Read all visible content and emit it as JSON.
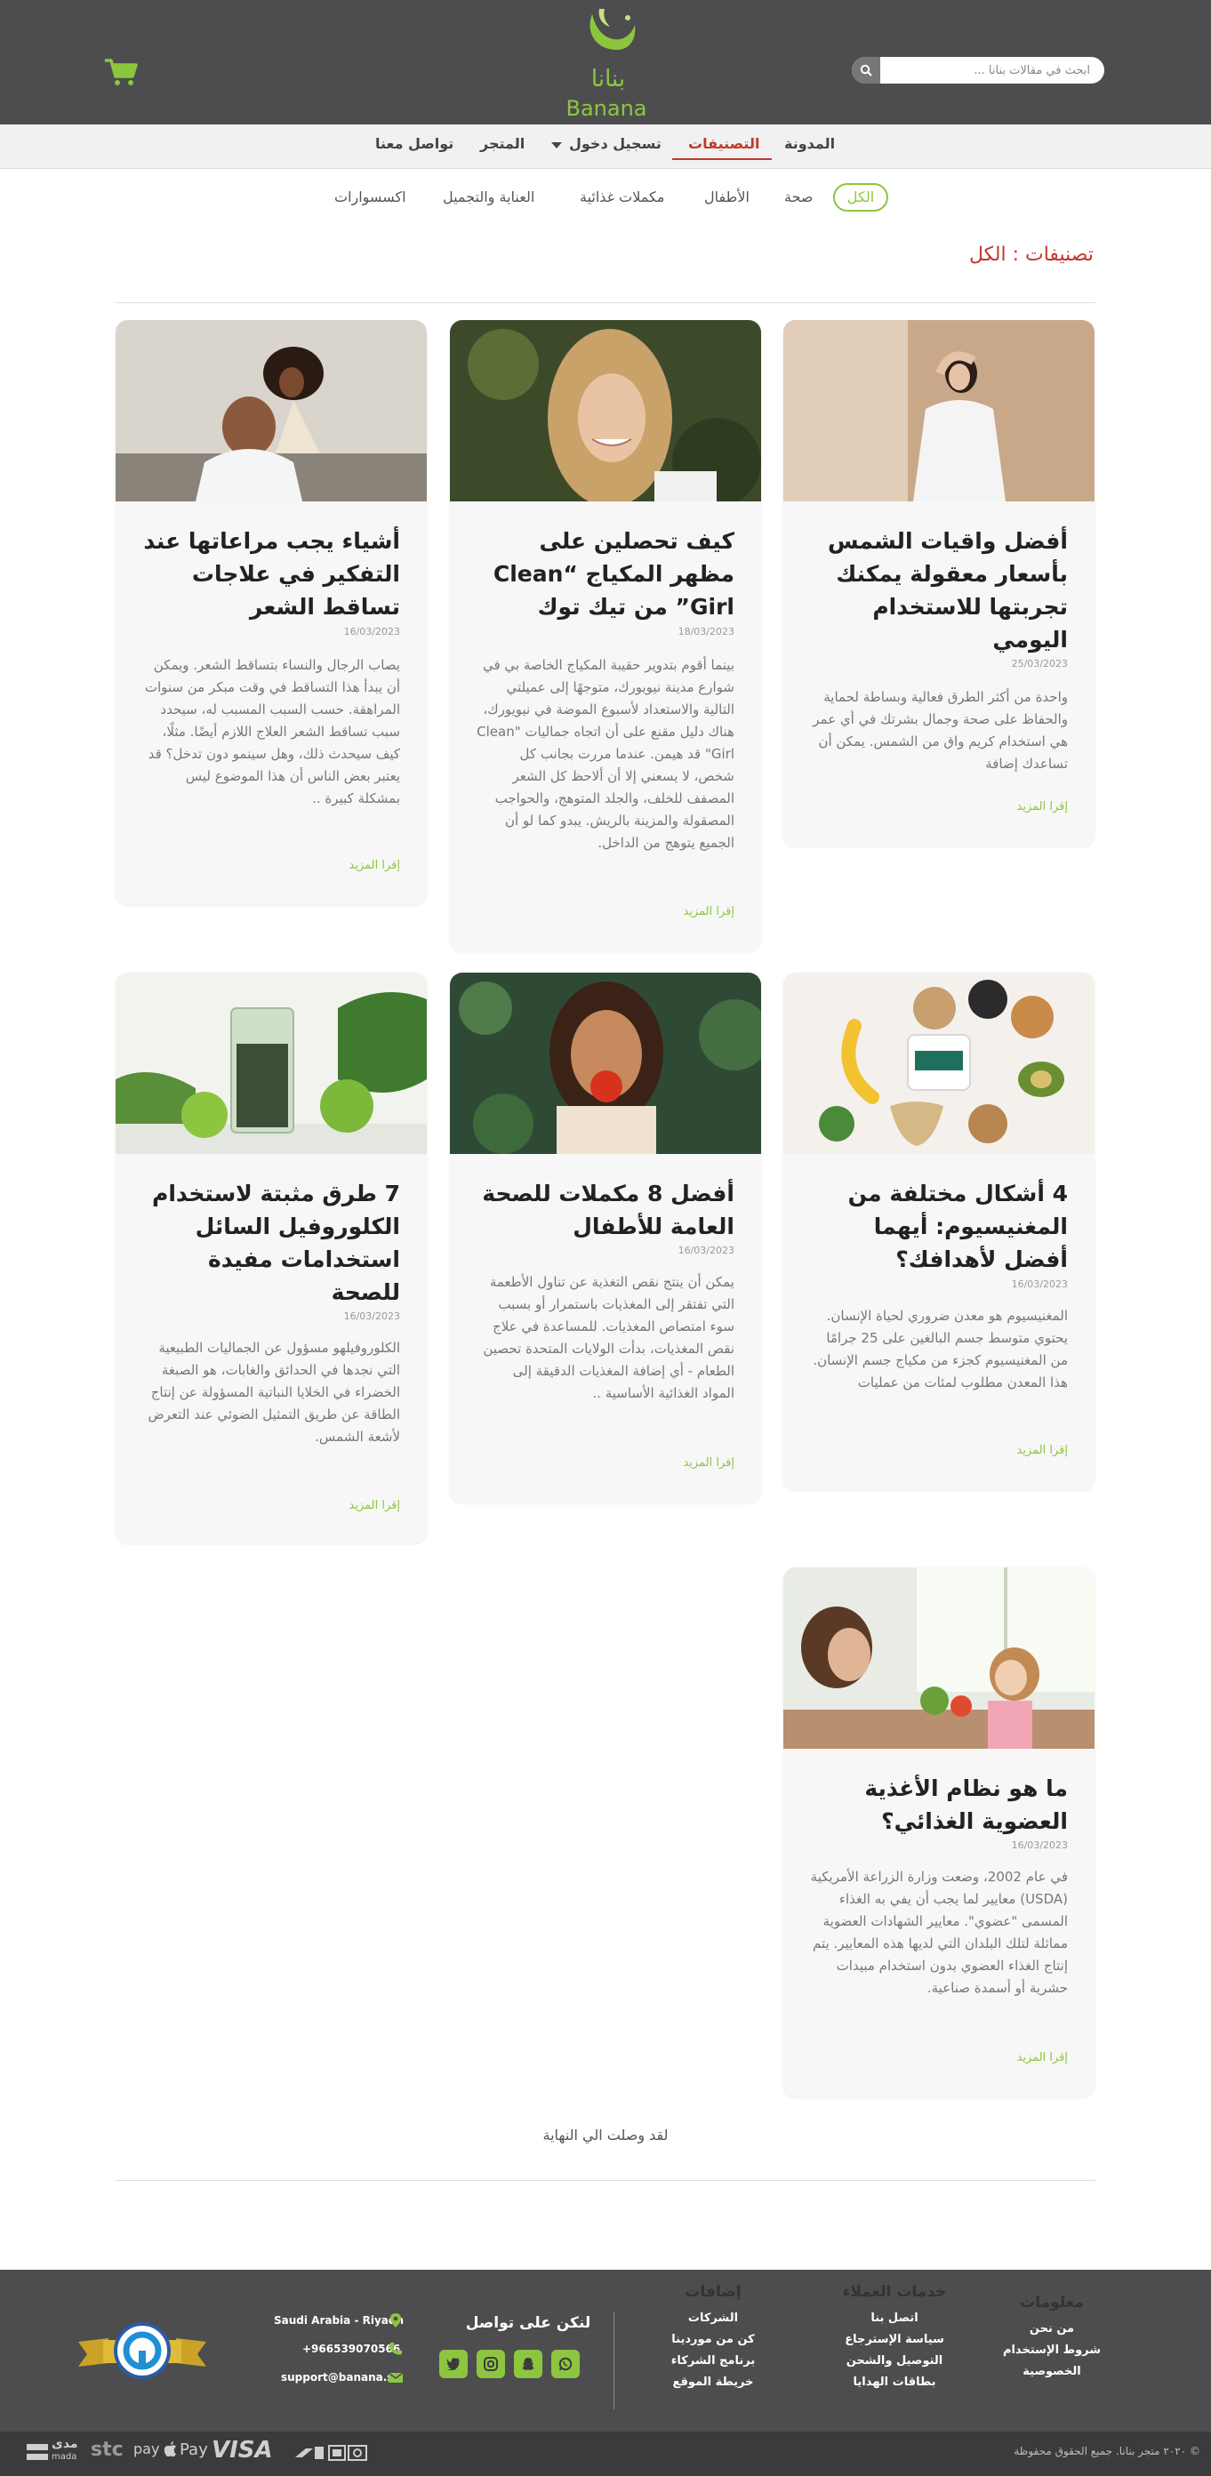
{
  "header": {
    "search_placeholder": "ابحث في مقالات بنانا ...",
    "logo_ar": "بنانا",
    "logo_en": "Banana"
  },
  "nav": {
    "items": [
      "المدونة",
      "التصنيفات",
      "تسجيل دخول",
      "المتجر",
      "تواصل معنا"
    ]
  },
  "categories": [
    "الكل",
    "صحة",
    "الأطفال",
    "مكملات غذائية",
    "العناية والتجميل",
    "اكسسوارات"
  ],
  "page_title": "تصنيفات : الكل",
  "posts": [
    {
      "title": "أفضل واقيات الشمس بأسعار معقولة يمكنك تجربتها للاستخدام اليومي",
      "date": "25/03/2023",
      "excerpt": "واحدة من أكثر الطرق فعالية وبساطة لحماية والحفاظ على صحة وجمال بشرتك في أي عمر هي استخدام كريم واق من الشمس. يمكن أن تساعدك إضافة",
      "more": "إقرا المزيد"
    },
    {
      "title": "كيف تحصلين على مظهر المكياج “Clean Girl” من تيك توك",
      "date": "18/03/2023",
      "excerpt": "بينما أقوم بتدوير حقيبة المكياج الخاصة بي في شوارع مدينة نيويورك، متوجهًا إلى عميلتي التالية والاستعداد لأسبوع الموضة في نيويورك، هناك دليل مقنع على أن اتجاه جماليات \"Clean Girl\" قد هيمن. عندما مررت بجانب كل شخص، لا يسعني إلا أن ألاحظ كل الشعر المصفف للخلف، والجلد المتوهج، والحواجب المصقولة والمزينة بالريش. يبدو كما لو أن الجميع يتوهج من الداخل.",
      "more": "إقرا المزيد"
    },
    {
      "title": "أشياء يجب مراعاتها عند التفكير في علاجات تساقط الشعر",
      "date": "16/03/2023",
      "excerpt": "يصاب الرجال والنساء بتساقط الشعر. ويمكن أن يبدأ هذا التساقط في وقت مبكر من سنوات المراهقة. حسب السبب المسبب له، سيحدد سبب تساقط الشعر العلاج اللازم أيضًا. مثلًا، كيف سيحدث ذلك، وهل سينمو دون تدخل؟ قد يعتبر بعض الناس أن هذا الموضوع ليس بمشكلة كبيرة ..",
      "more": "إقرا المزيد"
    },
    {
      "title": "4 أشكال مختلفة من المغنيسيوم: أيهما أفضل لأهدافك؟",
      "date": "16/03/2023",
      "excerpt": "المغنيسيوم هو معدن ضروري لحياة الإنسان. يحتوي متوسط جسم البالغين على 25 جرامًا من المغنيسيوم كجزء من مكياج جسم الإنسان. هذا المعدن مطلوب لمئات من عمليات",
      "more": "إقرا المزيد"
    },
    {
      "title": "أفضل 8 مكملات للصحة العامة للأطفال",
      "date": "16/03/2023",
      "excerpt": "يمكن أن ينتج نقص التغذية عن تناول الأطعمة التي تفتقر إلى المغذيات باستمرار أو بسبب سوء امتصاص المغذيات. للمساعدة في علاج نقص المغذيات، بدأت الولايات المتحدة تحصين الطعام - أي إضافة المغذيات الدقيقة إلى المواد الغذائية الأساسية ..",
      "more": "إقرا المزيد"
    },
    {
      "title": "7 طرق مثبتة لاستخدام الكلوروفيل السائل استخدامات مفيدة للصحة",
      "date": "16/03/2023",
      "excerpt": "الكلوروفيلهو مسؤول عن الجماليات الطبيعية التي نجدها في الحدائق والغابات، هو الصبغة الخضراء في الخلايا النباتية المسؤولة عن إنتاج الطاقة عن طريق التمثيل الضوئي عند التعرض لأشعة الشمس.",
      "more": "إقرا المزيد"
    },
    {
      "title": "ما هو نظام الأغذية العضوية الغذائي؟",
      "date": "16/03/2023",
      "excerpt": "في عام 2002، وضعت وزارة الزراعة الأمريكية (USDA) معايير لما يجب أن يفي به الغذاء المسمى \"عضوي\". معايير الشهادات العضوية مماثلة لتلك البلدان التي لديها هذه المعايير. يتم إنتاج الغذاء العضوي بدون استخدام مبيدات حشرية أو أسمدة صناعية.",
      "more": "إقرا المزيد"
    }
  ],
  "end_text": "لقد وصلت الي النهاية",
  "footer": {
    "info": {
      "title": "معلومات",
      "links": [
        "من نحن",
        "شروط الإستخدام",
        "الخصوصية"
      ]
    },
    "customer": {
      "title": "خدمات العملاء",
      "links": [
        "اتصل بنا",
        "سياسة الإسترجاع",
        "التوصيل والشحن",
        "بطاقات الهدايا"
      ]
    },
    "extras": {
      "title": "إضافات",
      "links": [
        "الشركات",
        "كن من موردينا",
        "برنامج الشركاء",
        "خريطة الموقع"
      ]
    },
    "contact_title": "لنكن على تواصل",
    "location": "Saudi Arabia - Riyadh",
    "phone": "+966539070566",
    "email": "support@banana.sa",
    "copyright": "© ٢٠٢٠ متجر بنانا. جميع الحقوق محفوظة",
    "payment": {
      "mada_ar": "مدى",
      "mada_en": "mada",
      "stc": "stc",
      "pay": "pay",
      "apple_pay": "Pay",
      "visa": "VISA"
    }
  },
  "colors": {
    "brand_green": "#8cc63f",
    "header_gray": "#4d4d4f",
    "accent_red": "#c0392b"
  }
}
